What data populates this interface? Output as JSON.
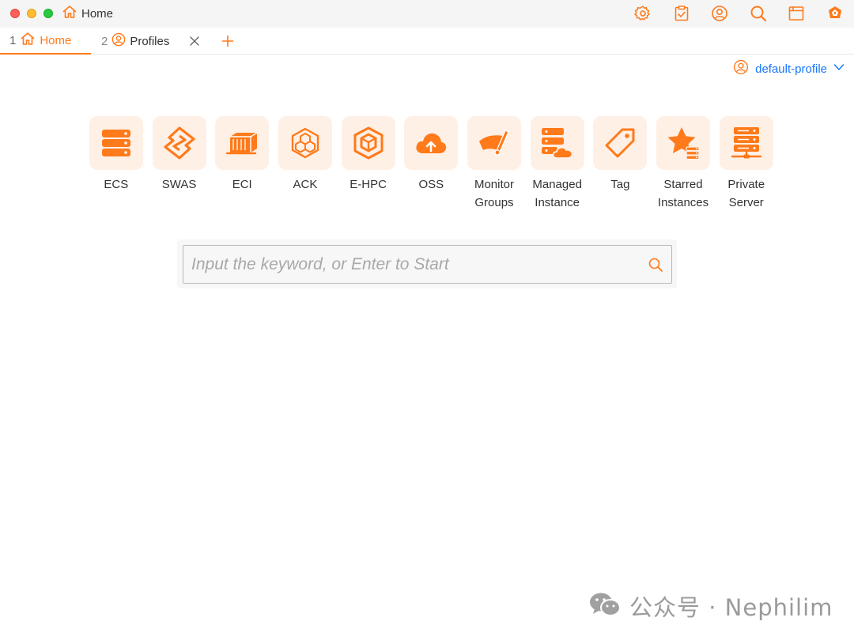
{
  "window": {
    "title": "Home"
  },
  "toolbar": {
    "icons": [
      "settings-icon",
      "tasks-icon",
      "account-icon",
      "search-icon",
      "window-icon",
      "logo-icon"
    ]
  },
  "tabs": [
    {
      "number": "1",
      "label": "Home",
      "icon": "home-icon",
      "active": true
    },
    {
      "number": "2",
      "label": "Profiles",
      "icon": "profile-icon",
      "active": false
    }
  ],
  "profile": {
    "label": "default-profile"
  },
  "services": [
    {
      "name": "ECS",
      "icon": "ecs-icon"
    },
    {
      "name": "SWAS",
      "icon": "swas-icon"
    },
    {
      "name": "ECI",
      "icon": "eci-icon"
    },
    {
      "name": "ACK",
      "icon": "ack-icon"
    },
    {
      "name": "E-HPC",
      "icon": "ehpc-icon"
    },
    {
      "name": "OSS",
      "icon": "oss-icon"
    },
    {
      "name": "Monitor\nGroups",
      "icon": "monitor-groups-icon"
    },
    {
      "name": "Managed\nInstance",
      "icon": "managed-instance-icon"
    },
    {
      "name": "Tag",
      "icon": "tag-icon"
    },
    {
      "name": "Starred\nInstances",
      "icon": "starred-instances-icon"
    },
    {
      "name": "Private\nServer",
      "icon": "private-server-icon"
    }
  ],
  "search": {
    "placeholder": "Input the keyword, or Enter to Start",
    "value": ""
  },
  "watermark": {
    "text": "公众号 · Nephilim"
  },
  "colors": {
    "accent": "#ff7a1a",
    "tile_bg": "#fff0e6",
    "link": "#1677ff"
  }
}
